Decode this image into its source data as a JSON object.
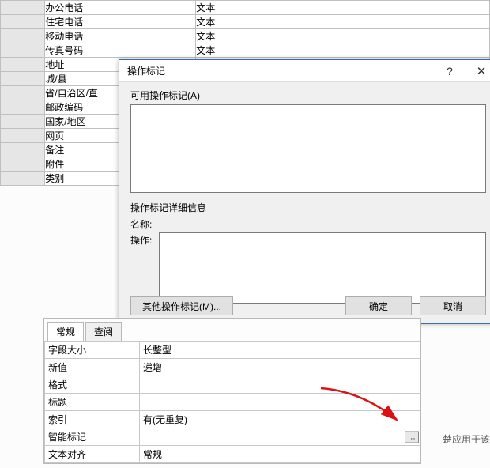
{
  "fields": {
    "rows": [
      {
        "name": "办公电话",
        "type": "文本"
      },
      {
        "name": "住宅电话",
        "type": "文本"
      },
      {
        "name": "移动电话",
        "type": "文本"
      },
      {
        "name": "传真号码",
        "type": "文本"
      },
      {
        "name": "地址",
        "type": ""
      },
      {
        "name": "城/县",
        "type": ""
      },
      {
        "name": "省/自治区/直",
        "type": ""
      },
      {
        "name": "邮政编码",
        "type": ""
      },
      {
        "name": "国家/地区",
        "type": ""
      },
      {
        "name": "网页",
        "type": ""
      },
      {
        "name": "备注",
        "type": ""
      },
      {
        "name": "附件",
        "type": ""
      },
      {
        "name": "类别",
        "type": ""
      }
    ]
  },
  "dialog": {
    "title": "操作标记",
    "help_glyph": "?",
    "close_glyph": "✕",
    "available_label": "可用操作标记(A)",
    "detail_label": "操作标记详细信息",
    "name_label": "名称:",
    "action_label": "操作:",
    "other_btn": "其他操作标记(M)...",
    "ok_btn": "确定",
    "cancel_btn": "取消"
  },
  "tabs": {
    "tab1": "常规",
    "tab2": "查阅"
  },
  "props": {
    "rows": [
      {
        "name": "字段大小",
        "value": "长整型"
      },
      {
        "name": "新值",
        "value": "递增"
      },
      {
        "name": "格式",
        "value": ""
      },
      {
        "name": "标题",
        "value": ""
      },
      {
        "name": "索引",
        "value": "有(无重复)"
      },
      {
        "name": "智能标记",
        "value": "",
        "picker": true
      },
      {
        "name": "文本对齐",
        "value": "常规"
      }
    ]
  },
  "picker_glyph": "...",
  "right_hint": "楚应用于该"
}
